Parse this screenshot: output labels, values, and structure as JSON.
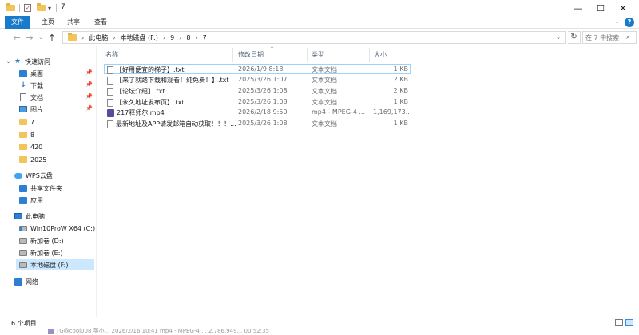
{
  "window": {
    "title": "7",
    "controls": {
      "minimize": "—",
      "maximize": "☐",
      "close": "✕"
    }
  },
  "ribbon": {
    "tabs": [
      "文件",
      "主页",
      "共享",
      "查看"
    ],
    "help": "?"
  },
  "address": {
    "crumbs": [
      "此电脑",
      "本地磁盘 (F:)",
      "9",
      "8",
      "7"
    ],
    "search_placeholder": "在 7 中搜索"
  },
  "sidebar": {
    "quick_access": "快速访问",
    "pinned": [
      "桌面",
      "下载",
      "文档",
      "图片"
    ],
    "folders": [
      "7",
      "8",
      "420",
      "2025"
    ],
    "wps": "WPS云盘",
    "wps_items": [
      "共享文件夹",
      "应用"
    ],
    "this_pc": "此电脑",
    "drives": [
      "Win10ProW X64 (C:)",
      "新加卷 (D:)",
      "新加卷 (E:)",
      "本地磁盘 (F:)"
    ],
    "network": "网络"
  },
  "columns": {
    "name": "名称",
    "date": "修改日期",
    "type": "类型",
    "size": "大小"
  },
  "files": [
    {
      "name": "【好用便宜的梯子】.txt",
      "date": "2026/1/9 8:18",
      "type": "文本文档",
      "size": "1 KB",
      "icon": "text-file"
    },
    {
      "name": "【来了就踏下载和观看！纯免费！】.txt",
      "date": "2025/3/26 1:07",
      "type": "文本文档",
      "size": "2 KB",
      "icon": "text-file"
    },
    {
      "name": "【论坛介绍】.txt",
      "date": "2025/3/26 1:08",
      "type": "文本文档",
      "size": "2 KB",
      "icon": "text-file"
    },
    {
      "name": "【永久地址发布页】.txt",
      "date": "2025/3/26 1:08",
      "type": "文本文档",
      "size": "1 KB",
      "icon": "text-file"
    },
    {
      "name": "217释师尔.mp4",
      "date": "2026/2/18 9:50",
      "type": "mp4 - MPEG-4 ...",
      "size": "1,169,173...",
      "icon": "video-file"
    },
    {
      "name": "最新地址及APP请发邮箱自动获取！！！...",
      "date": "2025/3/26 1:08",
      "type": "文本文档",
      "size": "1 KB",
      "icon": "text-file"
    }
  ],
  "status": {
    "item_count": "6 个项目"
  },
  "background_row": "TG@cool008 英小...   2026/2/16 10:41   mp4 - MPEG-4 ...   2,786,949...   00:52:35"
}
